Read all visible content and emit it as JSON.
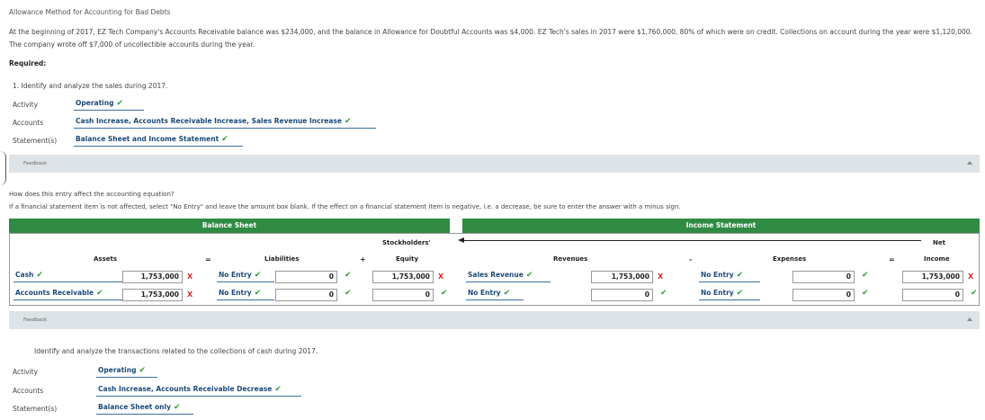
{
  "title": "Allowance Method for Accounting for Bad Debts",
  "problem_text": "At the beginning of 2017, EZ Tech Company's Accounts Receivable balance was $234,000, and the balance in Allowance for Doubtful Accounts was $4,000. EZ Tech's sales in 2017 were $1,760,000, 80% of which were on credit. Collections on account during the year were $1,120,000. The company wrote off $7,000 of uncollectible accounts during the year.",
  "required_label": "Required:",
  "part1": {
    "question": "1. Identify and analyze the sales during 2017.",
    "activity_label": "Activity",
    "activity_value": "Operating",
    "accounts_label": "Accounts",
    "accounts_value": "Cash Increase, Accounts Receivable Increase, Sales Revenue Increase",
    "statements_label": "Statement(s)",
    "statements_value": "Balance Sheet and Income Statement"
  },
  "feedback_label": "Feedback",
  "equation_question": "How does this entry affect the accounting equation?",
  "equation_instruction": "If a financial statement item is not affected, select \"No Entry\" and leave the amount box blank. If the effect on a financial statement item is negative, i.e. a decrease, be sure to enter the answer with a minus sign.",
  "table": {
    "balance_sheet_header": "Balance Sheet",
    "income_statement_header": "Income Statement",
    "stockholders_label": "Stockholders'",
    "equity_label": "Equity",
    "net_label": "Net",
    "income_label": "Income",
    "assets_label": "Assets",
    "liabilities_label": "Liabilities",
    "revenues_label": "Revenues",
    "expenses_label": "Expenses",
    "op_equals": "=",
    "op_plus": "+",
    "op_minus": "-",
    "rows": [
      {
        "asset_account": "Cash",
        "asset_amount": "1,753,000",
        "liability_account": "No Entry",
        "liability_amount": "0",
        "equity_amount": "1,753,000",
        "revenue_account": "Sales Revenue",
        "revenue_amount": "1,753,000",
        "expense_account": "No Entry",
        "expense_amount": "0",
        "net_income": "1,753,000"
      },
      {
        "asset_account": "Accounts Receivable",
        "asset_amount": "1,753,000",
        "liability_account": "No Entry",
        "liability_amount": "0",
        "equity_amount": "0",
        "revenue_account": "No Entry",
        "revenue_amount": "0",
        "expense_account": "No Entry",
        "expense_amount": "0",
        "net_income": "0"
      }
    ]
  },
  "part2": {
    "question": "Identify and analyze the transactions related to the collections of cash during 2017.",
    "activity_label": "Activity",
    "activity_value": "Operating",
    "accounts_label": "Accounts",
    "accounts_value": "Cash Increase, Accounts Receivable Decrease",
    "statements_label": "Statement(s)",
    "statements_value": "Balance Sheet only"
  },
  "marks": {
    "check": "✔",
    "cross": "X"
  },
  "colors": {
    "header_green": "#2f8a42",
    "check_green": "#2e9e3e",
    "cross_red": "#d62a2a",
    "answer_blue": "#1a4a7a"
  }
}
